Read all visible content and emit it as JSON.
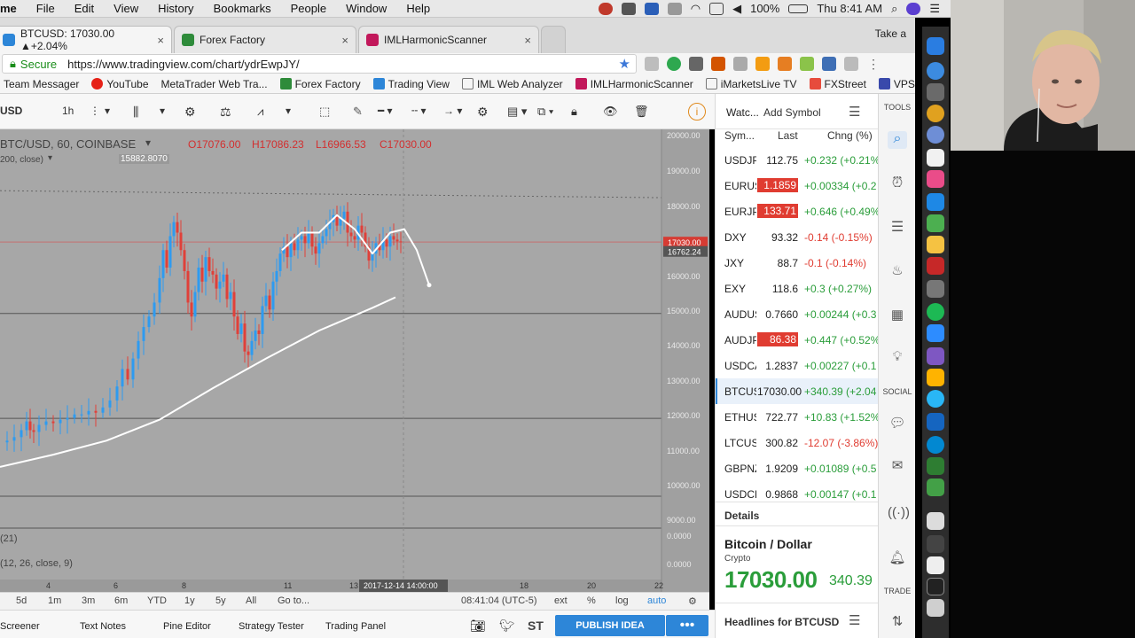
{
  "menubar": {
    "app": "me",
    "items": [
      "File",
      "Edit",
      "View",
      "History",
      "Bookmarks",
      "People",
      "Window",
      "Help"
    ],
    "battery": "100%",
    "clock": "Thu 8:41 AM"
  },
  "tabs": [
    {
      "title": "BTCUSD: 17030.00 ▲+2.04%",
      "close": "×"
    },
    {
      "title": "Forex Factory",
      "close": "×"
    },
    {
      "title": "IMLHarmonicScanner",
      "close": "×"
    }
  ],
  "take_a": "Take a",
  "address": {
    "secure": "Secure",
    "url": "https://www.tradingview.com/chart/ydrEwpJY/"
  },
  "bookmarks": [
    "Team Messager",
    "YouTube",
    "MetaTrader Web Tra...",
    "Forex Factory",
    "Trading View",
    "IML Web Analyzer",
    "IMLHarmonicScanner",
    "iMarketsLive TV",
    "FXStreet",
    "VPS"
  ],
  "toolbar": {
    "symbol": "USD",
    "interval": "1h",
    "watch_tab": "Watc...",
    "add_symbol": "Add Symbol",
    "tools_label": "TOOLS"
  },
  "legend": {
    "main": "BTC/USD, 60, COINBASE",
    "open": "O17076.00",
    "high": "H17086.23",
    "low": "L16966.53",
    "close": "C17030.00",
    "ma": "200, close)",
    "ma_value": "15882.8070",
    "ind1": "(21)",
    "ind2": "(12, 26, close, 9)"
  },
  "chart_data": {
    "type": "candlestick",
    "title": "BTC/USD, 60, COINBASE",
    "ohlc": {
      "open": 17076.0,
      "high": 17086.23,
      "low": 16966.53,
      "close": 17030.0
    },
    "price_axis_labels": [
      "20000.00",
      "19000.00",
      "18000.00",
      "17000.00",
      "16000.00",
      "15000.00",
      "14000.00",
      "13000.00",
      "12000.00",
      "11000.00",
      "10000.00",
      "9000.00",
      "0.0000",
      "0.0000"
    ],
    "ylim": [
      9000,
      20000
    ],
    "last_price_label": "17030.00",
    "crosshair_price_label": "16762.24",
    "x_axis_labels": [
      "4",
      "6",
      "8",
      "11",
      "13",
      "18",
      "20",
      "22"
    ],
    "crosshair_time_label": "2017-12-14 14:00:00",
    "moving_average": {
      "name": "200, close)",
      "value": 15882.807
    },
    "close_trace": [
      {
        "t": 0,
        "p": 11300
      },
      {
        "t": 8,
        "p": 11350
      },
      {
        "t": 16,
        "p": 11450
      },
      {
        "t": 24,
        "p": 11650
      },
      {
        "t": 30,
        "p": 11900
      },
      {
        "t": 34,
        "p": 11650
      },
      {
        "t": 38,
        "p": 11600
      },
      {
        "t": 44,
        "p": 11800
      },
      {
        "t": 52,
        "p": 11900
      },
      {
        "t": 60,
        "p": 11850
      },
      {
        "t": 68,
        "p": 11950
      },
      {
        "t": 76,
        "p": 12000
      },
      {
        "t": 84,
        "p": 12100
      },
      {
        "t": 92,
        "p": 12100
      },
      {
        "t": 100,
        "p": 12200
      },
      {
        "t": 108,
        "p": 12150
      },
      {
        "t": 116,
        "p": 12300
      },
      {
        "t": 124,
        "p": 12500
      },
      {
        "t": 132,
        "p": 12900
      },
      {
        "t": 138,
        "p": 13400
      },
      {
        "t": 144,
        "p": 13100
      },
      {
        "t": 150,
        "p": 13700
      },
      {
        "t": 156,
        "p": 14200
      },
      {
        "t": 162,
        "p": 14600
      },
      {
        "t": 168,
        "p": 14900
      },
      {
        "t": 174,
        "p": 15300
      },
      {
        "t": 180,
        "p": 16000
      },
      {
        "t": 184,
        "p": 16800
      },
      {
        "t": 188,
        "p": 16300
      },
      {
        "t": 192,
        "p": 17200
      },
      {
        "t": 196,
        "p": 17600
      },
      {
        "t": 200,
        "p": 17300
      },
      {
        "t": 204,
        "p": 16800
      },
      {
        "t": 208,
        "p": 16200
      },
      {
        "t": 212,
        "p": 15300
      },
      {
        "t": 216,
        "p": 14900
      },
      {
        "t": 220,
        "p": 15600
      },
      {
        "t": 224,
        "p": 16300
      },
      {
        "t": 228,
        "p": 15900
      },
      {
        "t": 232,
        "p": 16600
      },
      {
        "t": 236,
        "p": 16200
      },
      {
        "t": 240,
        "p": 16100
      },
      {
        "t": 244,
        "p": 15700
      },
      {
        "t": 248,
        "p": 15900
      },
      {
        "t": 252,
        "p": 16100
      },
      {
        "t": 256,
        "p": 15400
      },
      {
        "t": 260,
        "p": 15600
      },
      {
        "t": 264,
        "p": 14900
      },
      {
        "t": 268,
        "p": 14400
      },
      {
        "t": 272,
        "p": 14700
      },
      {
        "t": 276,
        "p": 13900
      },
      {
        "t": 280,
        "p": 13800
      },
      {
        "t": 284,
        "p": 14200
      },
      {
        "t": 288,
        "p": 14500
      },
      {
        "t": 292,
        "p": 14400
      },
      {
        "t": 296,
        "p": 15200
      },
      {
        "t": 300,
        "p": 15500
      },
      {
        "t": 304,
        "p": 15100
      },
      {
        "t": 308,
        "p": 15900
      },
      {
        "t": 312,
        "p": 16200
      },
      {
        "t": 316,
        "p": 16700
      },
      {
        "t": 320,
        "p": 16900
      },
      {
        "t": 324,
        "p": 16600
      },
      {
        "t": 328,
        "p": 17000
      },
      {
        "t": 332,
        "p": 16800
      },
      {
        "t": 336,
        "p": 17100
      },
      {
        "t": 340,
        "p": 17200
      },
      {
        "t": 344,
        "p": 17000
      },
      {
        "t": 348,
        "p": 17300
      },
      {
        "t": 352,
        "p": 16900
      },
      {
        "t": 356,
        "p": 16700
      },
      {
        "t": 360,
        "p": 17000
      },
      {
        "t": 364,
        "p": 17200
      },
      {
        "t": 368,
        "p": 17400
      },
      {
        "t": 372,
        "p": 17600
      },
      {
        "t": 376,
        "p": 17800
      },
      {
        "t": 380,
        "p": 17500
      },
      {
        "t": 384,
        "p": 17700
      },
      {
        "t": 388,
        "p": 17900
      },
      {
        "t": 392,
        "p": 17300
      },
      {
        "t": 396,
        "p": 17200
      },
      {
        "t": 400,
        "p": 17100
      },
      {
        "t": 404,
        "p": 17500
      },
      {
        "t": 408,
        "p": 17300
      },
      {
        "t": 412,
        "p": 16900
      },
      {
        "t": 416,
        "p": 16500
      },
      {
        "t": 420,
        "p": 16700
      },
      {
        "t": 424,
        "p": 17000
      },
      {
        "t": 428,
        "p": 16800
      },
      {
        "t": 432,
        "p": 17100
      },
      {
        "t": 436,
        "p": 16900
      },
      {
        "t": 440,
        "p": 17200
      },
      {
        "t": 444,
        "p": 17100
      },
      {
        "t": 448,
        "p": 17050
      },
      {
        "t": 452,
        "p": 17030
      }
    ],
    "ma_trace": [
      {
        "t": 0,
        "p": 10600
      },
      {
        "t": 60,
        "p": 10950
      },
      {
        "t": 120,
        "p": 11350
      },
      {
        "t": 180,
        "p": 11950
      },
      {
        "t": 240,
        "p": 12850
      },
      {
        "t": 300,
        "p": 13700
      },
      {
        "t": 360,
        "p": 14500
      },
      {
        "t": 420,
        "p": 15150
      },
      {
        "t": 446,
        "p": 15450
      }
    ],
    "projection": [
      {
        "t": 318,
        "p": 16800
      },
      {
        "t": 340,
        "p": 17300
      },
      {
        "t": 360,
        "p": 17300
      },
      {
        "t": 380,
        "p": 17800
      },
      {
        "t": 400,
        "p": 17400
      },
      {
        "t": 420,
        "p": 16700
      },
      {
        "t": 440,
        "p": 17300
      },
      {
        "t": 456,
        "p": 17400
      },
      {
        "t": 470,
        "p": 16800
      },
      {
        "t": 484,
        "p": 15800
      }
    ]
  },
  "watchlist": {
    "headers": {
      "sym": "Sym...",
      "last": "Last",
      "chg": "Chng (%)"
    },
    "rows": [
      {
        "sym": "USDJPY",
        "last": "112.75",
        "chg": "+0.232 (+0.21%",
        "dir": "up",
        "hl": false
      },
      {
        "sym": "EURUSD",
        "last": "1.1859",
        "chg": "+0.00334 (+0.2",
        "dir": "up",
        "hl": true
      },
      {
        "sym": "EURJPY",
        "last": "133.71",
        "chg": "+0.646 (+0.49%",
        "dir": "up",
        "hl": true
      },
      {
        "sym": "DXY",
        "last": "93.32",
        "chg": "-0.14 (-0.15%)",
        "dir": "down",
        "hl": false
      },
      {
        "sym": "JXY",
        "last": "88.7",
        "chg": "-0.1 (-0.14%)",
        "dir": "down",
        "hl": false
      },
      {
        "sym": "EXY",
        "last": "118.6",
        "chg": "+0.3 (+0.27%)",
        "dir": "up",
        "hl": false
      },
      {
        "sym": "AUDUSD",
        "last": "0.7660",
        "chg": "+0.00244 (+0.3",
        "dir": "up",
        "hl": false
      },
      {
        "sym": "AUDJPY",
        "last": "86.38",
        "chg": "+0.447 (+0.52%",
        "dir": "up",
        "hl": true
      },
      {
        "sym": "USDCAD",
        "last": "1.2837",
        "chg": "+0.00227 (+0.1",
        "dir": "up",
        "hl": false
      },
      {
        "sym": "BTCUSD",
        "last": "17030.00",
        "chg": "+340.39 (+2.04",
        "dir": "up",
        "hl": false,
        "active": true
      },
      {
        "sym": "ETHUSD",
        "last": "722.77",
        "chg": "+10.83 (+1.52%",
        "dir": "up",
        "hl": false
      },
      {
        "sym": "LTCUSD",
        "last": "300.82",
        "chg": "-12.07 (-3.86%)",
        "dir": "down",
        "hl": false
      },
      {
        "sym": "GBPNZD",
        "last": "1.9209",
        "chg": "+0.01089 (+0.5",
        "dir": "up",
        "hl": false
      },
      {
        "sym": "USDCHF",
        "last": "0.9868",
        "chg": "+0.00147 (+0.1",
        "dir": "up",
        "hl": false
      }
    ]
  },
  "details": {
    "label": "Details",
    "name": "Bitcoin / Dollar",
    "kind": "Crypto",
    "price": "17030.00",
    "change": "340.39",
    "headlines": "Headlines for BTCUSD"
  },
  "range_bar": {
    "ranges": [
      "5d",
      "1m",
      "3m",
      "6m",
      "YTD",
      "1y",
      "5y",
      "All"
    ],
    "goto": "Go to...",
    "clock": "08:41:04 (UTC-5)",
    "ext": "ext",
    "pct": "%",
    "log": "log",
    "auto": "auto"
  },
  "panel_bar": {
    "items": [
      "Screener",
      "Text Notes",
      "Pine Editor",
      "Strategy Tester",
      "Trading Panel"
    ],
    "st": "ST",
    "publish": "PUBLISH IDEA",
    "more": "•••"
  },
  "tools_strip": {
    "social": "SOCIAL",
    "trade": "TRADE"
  },
  "colors": {
    "accent": "#2d86d8",
    "up": "#2a9d3a",
    "down": "#e03c31",
    "candle_up": "#2e9bf0",
    "candle_down": "#e0403a",
    "chart_bg": "#a7a7a7"
  }
}
